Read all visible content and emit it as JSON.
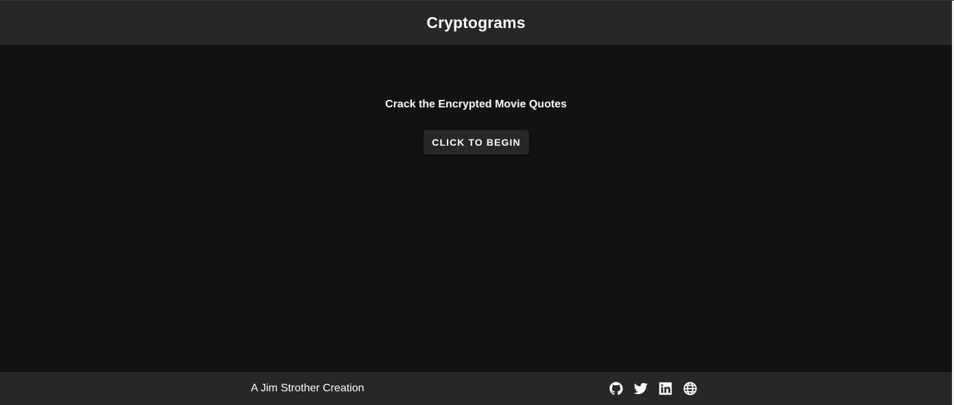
{
  "header": {
    "title": "Cryptograms"
  },
  "main": {
    "subtitle": "Crack the Encrypted Movie Quotes",
    "begin_button_label": "CLICK TO BEGIN"
  },
  "footer": {
    "credit": "A Jim Strother Creation",
    "social_links": [
      {
        "icon": "github-icon"
      },
      {
        "icon": "twitter-icon"
      },
      {
        "icon": "linkedin-icon"
      },
      {
        "icon": "globe-icon"
      }
    ]
  },
  "colors": {
    "background": "#121212",
    "bar": "#272727",
    "text": "#ffffff"
  }
}
